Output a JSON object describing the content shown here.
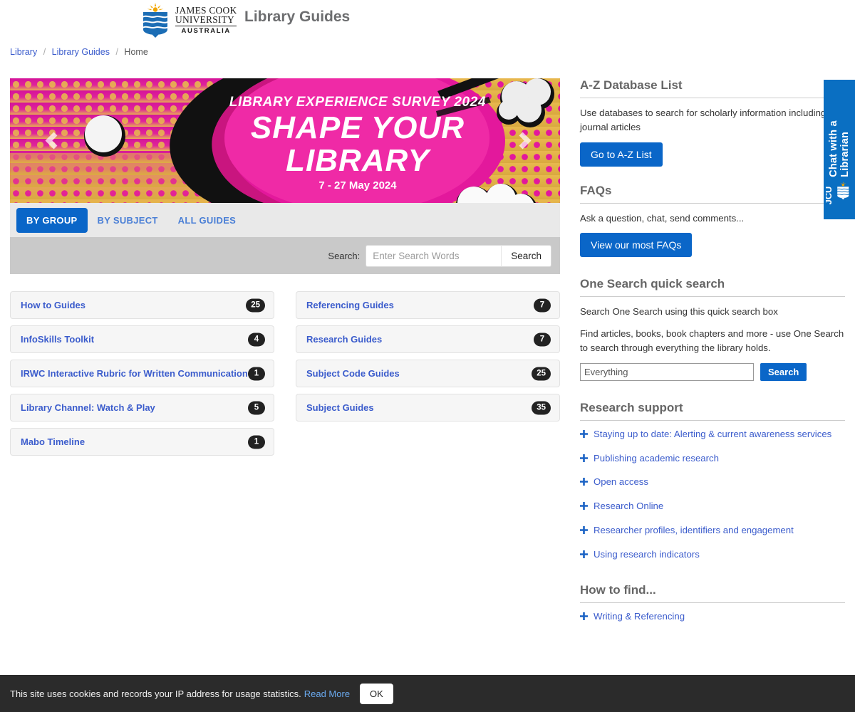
{
  "header": {
    "logo_line1": "JAMES COOK",
    "logo_line2": "UNIVERSITY",
    "logo_line3": "AUSTRALIA",
    "site_title": "Library Guides"
  },
  "breadcrumb": {
    "items": [
      {
        "label": "Library",
        "current": false
      },
      {
        "label": "Library Guides",
        "current": false
      },
      {
        "label": "Home",
        "current": true
      }
    ],
    "separator": "/"
  },
  "banner": {
    "eyebrow": "LIBRARY EXPERIENCE SURVEY 2024",
    "line1": "SHAPE YOUR",
    "line2": "LIBRARY",
    "dates": "7 - 27 May 2024",
    "prev_icon": "chevron-left-icon",
    "next_icon": "chevron-right-icon",
    "colors": {
      "magenta": "#e3189c",
      "gold": "#e8b44a",
      "black": "#111111"
    }
  },
  "tabs": [
    {
      "label": "By Group",
      "active": true
    },
    {
      "label": "By Subject",
      "active": false
    },
    {
      "label": "All Guides",
      "active": false
    }
  ],
  "guide_search": {
    "label": "Search:",
    "placeholder": "Enter Search Words",
    "value": "",
    "button": "Search"
  },
  "guide_groups": {
    "left": [
      {
        "title": "How to Guides",
        "count": "25"
      },
      {
        "title": "InfoSkills Toolkit",
        "count": "4"
      },
      {
        "title": "IRWC Interactive Rubric for Written Communication",
        "count": "1"
      },
      {
        "title": "Library Channel: Watch & Play",
        "count": "5"
      },
      {
        "title": "Mabo Timeline",
        "count": "1"
      }
    ],
    "right": [
      {
        "title": "Referencing Guides",
        "count": "7"
      },
      {
        "title": "Research Guides",
        "count": "7"
      },
      {
        "title": "Subject Code Guides",
        "count": "25"
      },
      {
        "title": "Subject Guides",
        "count": "35"
      }
    ]
  },
  "sidebar": {
    "az": {
      "heading": "A-Z Database List",
      "description": "Use databases to search for scholarly information including journal articles",
      "button": "Go to A-Z List"
    },
    "faqs": {
      "heading": "FAQs",
      "description": "Ask a question, chat, send comments...",
      "button": "View our most FAQs"
    },
    "one_search": {
      "heading": "One Search quick search",
      "p1": "Search One Search using this quick search box",
      "p2": "Find articles, books, book chapters and more - use One Search to search through everything the library holds.",
      "placeholder": "Everything",
      "value": "",
      "button": "Search"
    },
    "research_support": {
      "heading": "Research support",
      "links": [
        "Staying up to date: Alerting & current awareness services",
        "Publishing academic research",
        "Open access",
        "Research Online",
        "Researcher profiles, identifiers and engagement",
        "Using research indicators"
      ]
    },
    "how_to_find": {
      "heading": "How to find...",
      "links": [
        "Writing & Referencing"
      ]
    }
  },
  "chat_widget": {
    "label": "Chat with a Librarian",
    "logo_text": "JCU"
  },
  "cookie_bar": {
    "text": "This site uses cookies and records your IP address for usage statistics.",
    "link": "Read More",
    "button": "OK"
  },
  "colors": {
    "accent_blue": "#0a66c8",
    "link_blue": "#3b5ccc",
    "heading_grey": "#666666",
    "badge_dark": "#222222"
  }
}
